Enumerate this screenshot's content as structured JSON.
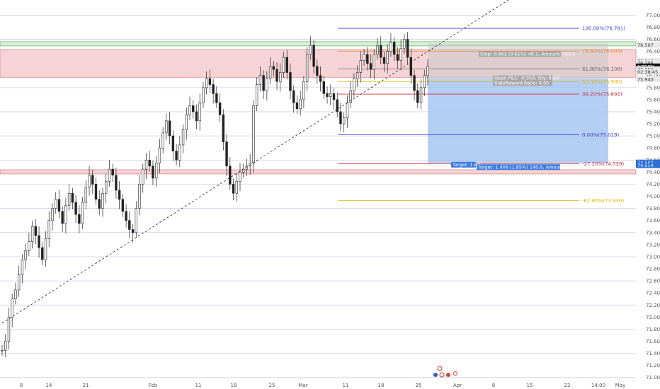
{
  "chart_data": {
    "type": "candlestick",
    "symbol_label": "NZDJPY",
    "ylim": [
      70.95,
      77.25
    ],
    "y_ticks": [
      "77.000",
      "76.800",
      "76.600",
      "76.400",
      "76.200",
      "76.000",
      "75.800",
      "75.600",
      "75.400",
      "75.200",
      "75.000",
      "74.800",
      "74.600",
      "74.400",
      "74.200",
      "74.000",
      "73.800",
      "73.600",
      "73.400",
      "73.200",
      "73.000",
      "72.800",
      "72.600",
      "72.400",
      "72.200",
      "72.000",
      "71.800",
      "71.600",
      "71.400",
      "71.200",
      "71.000"
    ],
    "x_ticks": [
      "8",
      "14",
      "21",
      "Feb",
      "11",
      "18",
      "25",
      "Mar",
      "11",
      "18",
      "25",
      "Apr",
      "8",
      "15",
      "22",
      "14:00",
      "May"
    ],
    "price_tags": [
      {
        "text": "76.507",
        "value": 76.507,
        "color": "#e8e8e8",
        "text_color": "#333"
      },
      {
        "text": "76.240",
        "value": 76.24,
        "color": "#e8e8e8",
        "text_color": "#333"
      },
      {
        "text": "76.206",
        "value": 76.206,
        "color": "#e8e8e8",
        "text_color": "#333"
      },
      {
        "text": "NZDJPY",
        "value": 76.152,
        "color": "#111111",
        "text_color": "#fff"
      },
      {
        "text": "76.152",
        "value": 76.105,
        "color": "#e8e8e8",
        "text_color": "#333"
      },
      {
        "text": "02:38:45",
        "value": 76.06,
        "color": "#e8e8e8",
        "text_color": "#333"
      },
      {
        "text": "75.940",
        "value": 75.94,
        "color": "#e8e8e8",
        "text_color": "#333"
      },
      {
        "text": "74.560",
        "value": 74.56,
        "color": "#2f6fd6",
        "text_color": "#fff"
      },
      {
        "text": "74.514",
        "value": 74.514,
        "color": "#2f6fd6",
        "text_color": "#fff"
      }
    ],
    "fib_levels": [
      {
        "label": "100.00%(76.781)",
        "value": 76.781,
        "color": "#3b3bd6"
      },
      {
        "label": "78.60%(76.404)",
        "value": 76.404,
        "color": "#e08a1e"
      },
      {
        "label": "61.80%(76.108)",
        "value": 76.108,
        "color": "#666666"
      },
      {
        "label": "50.00%(75.900)",
        "value": 75.9,
        "color": "#e0b400"
      },
      {
        "label": "38.20%(75.692)",
        "value": 75.692,
        "color": "#d03030"
      },
      {
        "label": "0.00%(75.019)",
        "value": 75.019,
        "color": "#3b3bd6"
      },
      {
        "label": "-27.20%(74.539)",
        "value": 74.539,
        "color": "#d03030"
      },
      {
        "label": "-61.80%(73.930)",
        "value": 73.93,
        "color": "#e0b400"
      }
    ],
    "position_labels": {
      "stop_top": "Stop: 0.461 (0.61%) 46.1, Amount: 750.5",
      "open_pnl": "Open P&L: -0.356, Qty: 8.63",
      "risk_reward": "Risk/Reward Ratio: 4.05",
      "target_small": "Target: 1.64",
      "target_full": "Target: 1.406 (1.85%) 140.6, Amount: 2171.2"
    },
    "zones": {
      "green": [
        76.49,
        76.56
      ],
      "red": [
        75.97,
        76.43
      ],
      "red_lower": [
        74.37,
        74.44
      ]
    },
    "series": [
      {
        "values": [
          71.45,
          71.6,
          72.0,
          72.3,
          72.45,
          72.7,
          72.95,
          73.1,
          73.25,
          73.5,
          73.35,
          73.15,
          72.95,
          73.3,
          73.6,
          73.8,
          73.95,
          73.75,
          73.55,
          73.85,
          74.05,
          73.9,
          73.7,
          73.55,
          73.9,
          74.15,
          74.35,
          74.2,
          73.95,
          73.8,
          74.05,
          74.25,
          74.45,
          74.35,
          74.1,
          73.95,
          73.75,
          73.6,
          73.45,
          73.4,
          73.8,
          74.2,
          74.45,
          74.6,
          74.5,
          74.3,
          74.55,
          74.8,
          75.05,
          75.25,
          75.0,
          74.75,
          74.6,
          74.85,
          75.1,
          75.35,
          75.5,
          75.4,
          75.25,
          75.55,
          75.8,
          75.95,
          75.85,
          75.7,
          75.55,
          75.35,
          74.9,
          74.5,
          74.2,
          74.05,
          74.25,
          74.4,
          74.45,
          74.5,
          74.55,
          75.5,
          75.85,
          76.0,
          75.75,
          75.95,
          76.15,
          76.1,
          75.9,
          76.05,
          76.3,
          76.05,
          75.75,
          75.55,
          75.45,
          75.6,
          75.9,
          76.35,
          76.5,
          76.15,
          76.0,
          75.9,
          75.7,
          75.65,
          75.7,
          75.6,
          75.4,
          75.2,
          75.3,
          75.55,
          75.75,
          75.95,
          76.05,
          76.25,
          76.35,
          76.2,
          76.1,
          76.35,
          76.5,
          76.3,
          76.2,
          76.4,
          76.55,
          76.35,
          76.25,
          76.45,
          76.6,
          76.3,
          76.0,
          75.75,
          75.55,
          75.8,
          76.0,
          76.15
        ]
      }
    ]
  }
}
